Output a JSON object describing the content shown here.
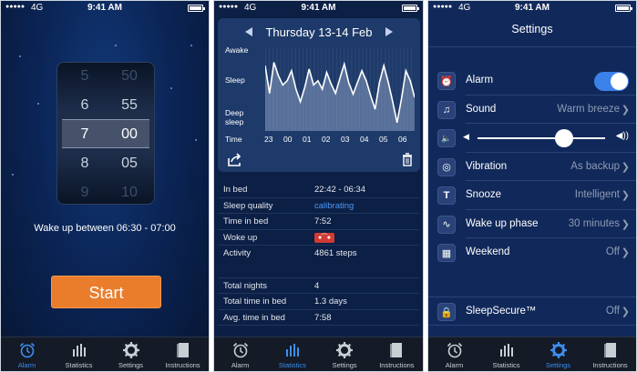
{
  "status": {
    "signal": "●●●●●",
    "network": "4G",
    "time": "9:41 AM"
  },
  "tabs": [
    "Alarm",
    "Statistics",
    "Settings",
    "Instructions"
  ],
  "alarm_screen": {
    "hours": [
      "5",
      "6",
      "7",
      "8",
      "9"
    ],
    "minutes": [
      "50",
      "55",
      "00",
      "05",
      "10"
    ],
    "wake_text": "Wake up between 06:30 - 07:00",
    "start_label": "Start"
  },
  "stats_screen": {
    "date_title": "Thursday 13-14 Feb",
    "y_labels": [
      "Awake",
      "Sleep",
      "Deep sleep",
      "Time"
    ],
    "x_labels": [
      "23",
      "00",
      "01",
      "02",
      "03",
      "04",
      "05",
      "06"
    ],
    "sleep_curve": [
      0.78,
      0.45,
      0.82,
      0.66,
      0.55,
      0.6,
      0.72,
      0.5,
      0.35,
      0.52,
      0.74,
      0.55,
      0.6,
      0.5,
      0.7,
      0.56,
      0.45,
      0.63,
      0.8,
      0.58,
      0.44,
      0.58,
      0.72,
      0.6,
      0.42,
      0.26,
      0.58,
      0.78,
      0.58,
      0.35,
      0.1,
      0.38,
      0.72,
      0.6,
      0.4
    ],
    "rows": [
      {
        "k": "In bed",
        "v": "22:42 - 06:34"
      },
      {
        "k": "Sleep quality",
        "v": "calibrating"
      },
      {
        "k": "Time in bed",
        "v": "7:52"
      },
      {
        "k": "Woke up",
        "v": ""
      },
      {
        "k": "Activity",
        "v": "4861 steps"
      }
    ],
    "summary": [
      {
        "k": "Total nights",
        "v": "4"
      },
      {
        "k": "Total time in bed",
        "v": "1.3 days"
      },
      {
        "k": "Avg. time in bed",
        "v": "7:58"
      }
    ]
  },
  "settings_screen": {
    "title": "Settings",
    "alarm_label": "Alarm",
    "alarm_on": true,
    "sound": {
      "label": "Sound",
      "value": "Warm breeze"
    },
    "volume_level": 0.67,
    "vibration": {
      "label": "Vibration",
      "value": "As backup"
    },
    "snooze": {
      "label": "Snooze",
      "value": "Intelligent"
    },
    "wake_phase": {
      "label": "Wake up phase",
      "value": "30 minutes"
    },
    "weekend": {
      "label": "Weekend",
      "value": "Off"
    },
    "secure": {
      "label": "SleepSecure™",
      "value": "Off"
    }
  }
}
